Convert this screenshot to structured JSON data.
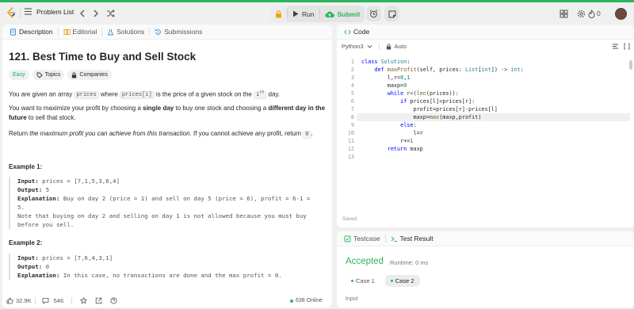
{
  "nav": {
    "problem_list": "Problem List",
    "run": "Run",
    "submit": "Submit",
    "streak": "0"
  },
  "left_tabs": [
    "Description",
    "Editorial",
    "Solutions",
    "Submissions"
  ],
  "problem": {
    "title": "121. Best Time to Buy and Sell Stock",
    "difficulty": "Easy",
    "topics": "Topics",
    "companies": "Companies",
    "p1_a": "You are given an array ",
    "p1_code1": "prices",
    "p1_b": " where ",
    "p1_code2": "prices[i]",
    "p1_c": " is the price of a given stock on the ",
    "p1_i": "i",
    "p1_th": "th",
    "p1_d": " day.",
    "p2_a": "You want to maximize your profit by choosing a ",
    "p2_b1": "single day",
    "p2_b": " to buy one stock and choosing a ",
    "p2_b2": "different day in the future",
    "p2_c": " to sell that stock.",
    "p3_a": "Return ",
    "p3_i": "the maximum profit you can achieve from this transaction",
    "p3_b": ". If you cannot achieve any profit, return ",
    "p3_code": "0",
    "p3_c": "."
  },
  "examples": [
    {
      "heading": "Example 1:",
      "input_label": "Input:",
      "input": " prices = [7,1,5,3,6,4]",
      "output_label": "Output:",
      "output": " 5",
      "expl_label": "Explanation:",
      "expl_lines": [
        " Buy on day 2 (price = 1) and sell on day 5 (price = 6), profit = 6-1 =",
        "5.",
        "Note that buying on day 2 and selling on day 1 is not allowed because you must buy",
        "before you sell."
      ]
    },
    {
      "heading": "Example 2:",
      "input_label": "Input:",
      "input": " prices = [7,6,4,3,1]",
      "output_label": "Output:",
      "output": " 0",
      "expl_label": "Explanation:",
      "expl_lines": [
        " In this case, no transactions are done and the max profit = 0."
      ]
    }
  ],
  "footer": {
    "likes": "32.9K",
    "comments": "546",
    "online": "638 Online"
  },
  "code_panel": {
    "tab": "Code",
    "language": "Python3",
    "auto": "Auto",
    "saved": "Saved",
    "lines": [
      "class Solution:",
      "    def maxProfit(self, prices: List[int]) -> int:",
      "        l,r=0,1",
      "        maxp=0",
      "        while r<(len(prices)):",
      "            if prices[l]<prices[r]:",
      "                profit=prices[r]-prices[l]",
      "                maxp=max(maxp,profit)",
      "            else:",
      "                l=r",
      "            r+=1",
      "        return maxp",
      ""
    ],
    "highlighted_line": 8
  },
  "result_panel": {
    "tabs": [
      "Testcase",
      "Test Result"
    ],
    "status": "Accepted",
    "runtime": "Runtime: 0 ms",
    "cases": [
      "Case 1",
      "Case 2"
    ],
    "input_label": "Input"
  },
  "colors": {
    "accent_green": "#2db55d",
    "easy": "#00af9b"
  }
}
